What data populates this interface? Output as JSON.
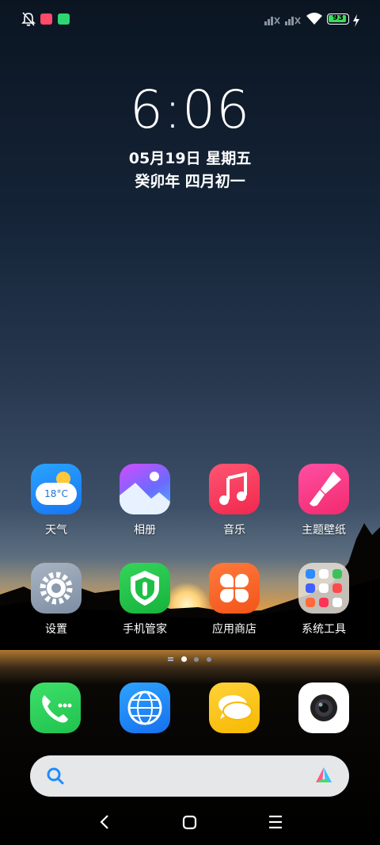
{
  "status_bar": {
    "battery_level": "93",
    "icons": [
      "mute-bell-icon",
      "voicemail-icon",
      "app-notification-icon",
      "signal-no-service-icon",
      "signal-no-service-icon",
      "wifi-icon",
      "battery-icon",
      "charging-bolt-icon"
    ]
  },
  "lockscreen": {
    "time": "6:06",
    "date": "05月19日 星期五",
    "lunar_date": "癸卯年 四月初一"
  },
  "weather_widget": {
    "temperature": "18°C"
  },
  "apps": [
    {
      "label": "天气",
      "icon": "weather-icon"
    },
    {
      "label": "相册",
      "icon": "gallery-icon"
    },
    {
      "label": "音乐",
      "icon": "music-icon"
    },
    {
      "label": "主题壁纸",
      "icon": "themes-icon"
    },
    {
      "label": "设置",
      "icon": "settings-icon"
    },
    {
      "label": "手机管家",
      "icon": "security-icon"
    },
    {
      "label": "应用商店",
      "icon": "app-store-icon"
    },
    {
      "label": "系统工具",
      "icon": "folder-icon"
    }
  ],
  "page_indicator": {
    "pages": 3,
    "current": 1
  },
  "dock": [
    {
      "icon": "phone-icon"
    },
    {
      "icon": "browser-icon"
    },
    {
      "icon": "messages-icon"
    },
    {
      "icon": "camera-icon"
    }
  ],
  "search_bar": {
    "icons": [
      "search-icon",
      "assistant-icon"
    ]
  },
  "navigation": {
    "icons": [
      "back-icon",
      "home-icon",
      "menu-icon"
    ]
  }
}
